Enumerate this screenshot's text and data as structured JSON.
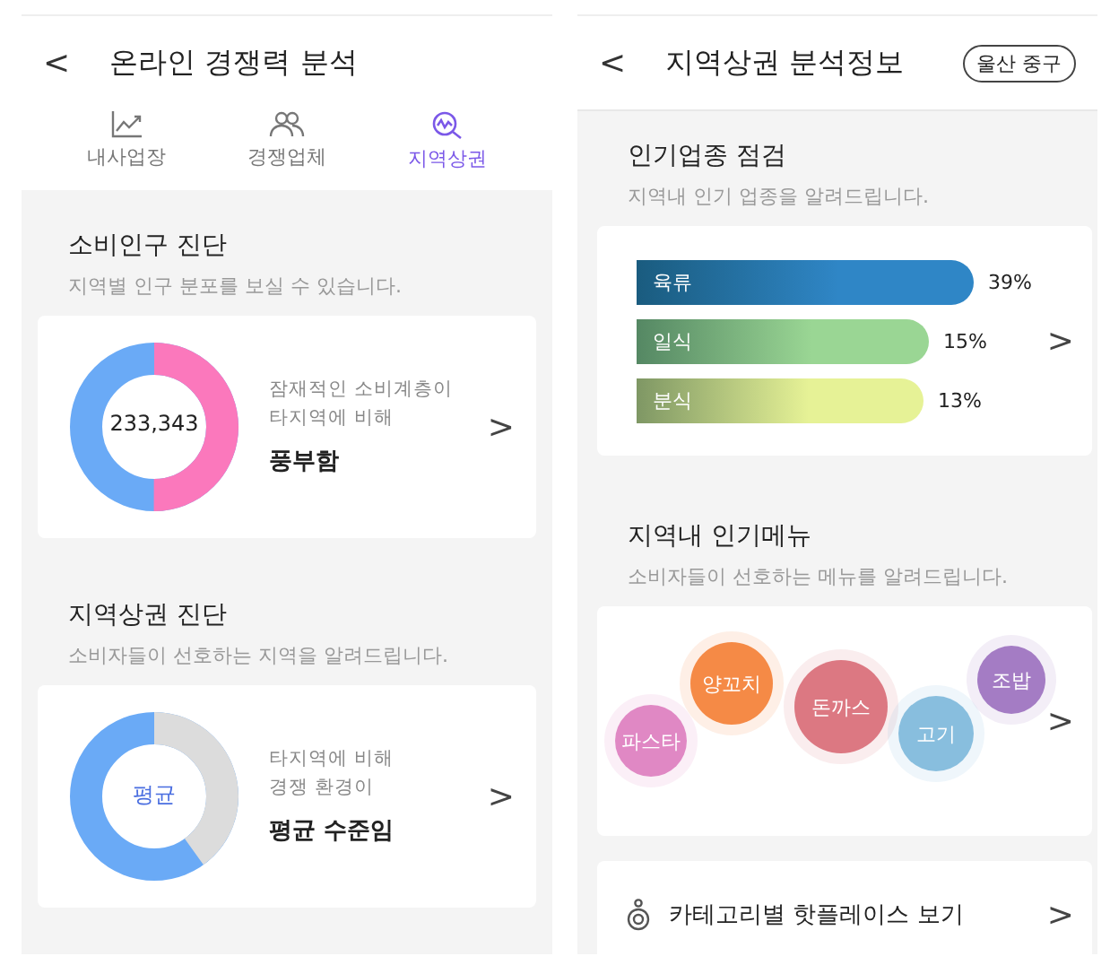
{
  "left": {
    "header": {
      "back": "<",
      "title": "온라인 경쟁력 분석"
    },
    "tabs": [
      {
        "label": "내사업장",
        "selected": false
      },
      {
        "label": "경쟁업체",
        "selected": false
      },
      {
        "label": "지역상권",
        "selected": true
      }
    ],
    "sections": [
      {
        "title": "소비인구 진단",
        "subtitle": "지역별 인구 분포를 보실 수 있습니다.",
        "center": "233,343",
        "desc": [
          "잠재적인 소비계층이",
          "타지역에 비해"
        ],
        "result": "풍부함",
        "chevron": ">"
      },
      {
        "title": "지역상권 진단",
        "subtitle": "소비자들이 선호하는 지역을 알려드립니다.",
        "center": "평균",
        "desc": [
          "타지역에 비해",
          "경쟁 환경이"
        ],
        "result": "평균 수준임",
        "chevron": ">"
      }
    ]
  },
  "right": {
    "header": {
      "back": "<",
      "title": "지역상권 분석정보",
      "badge": "울산 중구"
    },
    "industry": {
      "title": "인기업종 점검",
      "subtitle": "지역내 인기 업종을 알려드립니다.",
      "chevron": ">",
      "bars": [
        {
          "label": "육류",
          "value": "39%",
          "color": "#2f86c6"
        },
        {
          "label": "일식",
          "value": "15%",
          "color": "#9ad694"
        },
        {
          "label": "분식",
          "value": "13%",
          "color": "#e6f296"
        }
      ]
    },
    "menu": {
      "title": "지역내 인기메뉴",
      "subtitle": "소비자들이 선호하는 메뉴를 알려드립니다.",
      "chevron": ">",
      "bubbles": [
        {
          "label": "파스타",
          "color": "#e088c4"
        },
        {
          "label": "양꼬치",
          "color": "#f58a46"
        },
        {
          "label": "돈까스",
          "color": "#dc7882"
        },
        {
          "label": "고기",
          "color": "#88bede"
        },
        {
          "label": "조밥",
          "color": "#a47cc4"
        }
      ]
    },
    "link": {
      "label": "카테고리별 핫플레이스 보기",
      "chevron": ">"
    }
  }
}
